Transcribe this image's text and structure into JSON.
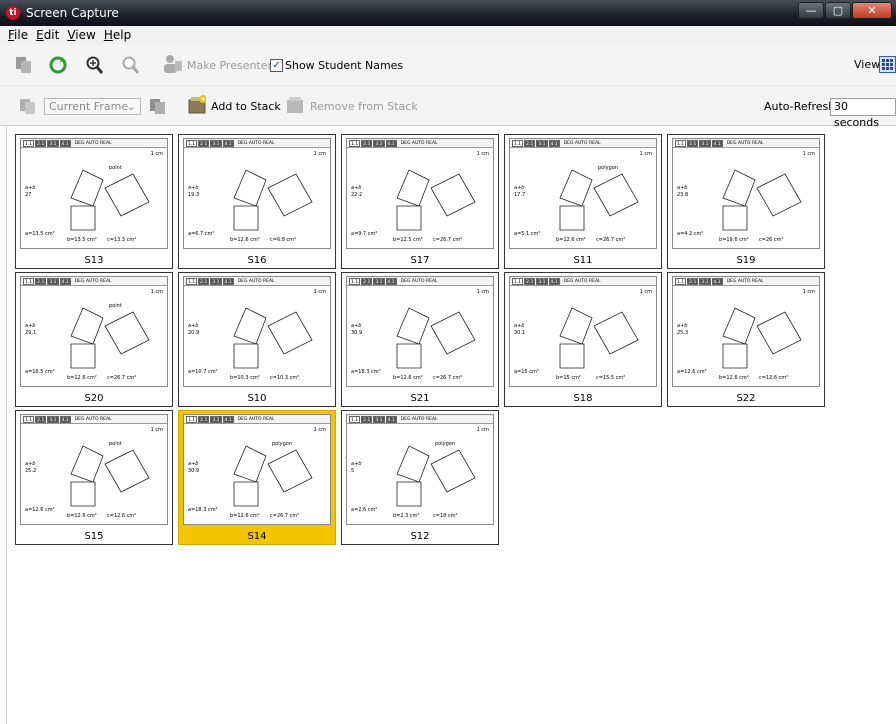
{
  "window": {
    "title": "Screen Capture"
  },
  "menu": [
    {
      "label": "File",
      "key": "F",
      "rest": "ile"
    },
    {
      "label": "Edit",
      "key": "E",
      "rest": "dit"
    },
    {
      "label": "View",
      "key": "V",
      "rest": "iew"
    },
    {
      "label": "Help",
      "key": "H",
      "rest": "elp"
    }
  ],
  "toolbar1": {
    "make_presenter": "Make Presenter",
    "show_student_names": "Show Student Names",
    "show_student_names_checked": true,
    "view_label": "View"
  },
  "toolbar2": {
    "current_frame": "Current Frame",
    "add_to_stack": "Add to Stack",
    "remove_from_stack": "Remove from Stack",
    "auto_refresh_label": "Auto-Refresh:",
    "auto_refresh_value": "30 seconds"
  },
  "page_tabs": [
    "1.1",
    "2.1",
    "3.1",
    "4.1"
  ],
  "page_info": "DEG AUTO REAL",
  "scale_label": "1 cm",
  "selected_student": "S14",
  "students": [
    {
      "name": "S13",
      "ab_label": "a+b",
      "ab_value": "27",
      "a": "a=13.5 cm²",
      "b": "b=13.5 cm²",
      "c": "c=13.3 cm²",
      "tool": "point"
    },
    {
      "name": "S16",
      "ab_label": "a+b",
      "ab_value": "19.3",
      "a": "a=6.7 cm²",
      "b": "b=12.6 cm²",
      "c": "c=6.8 cm²",
      "tool": ""
    },
    {
      "name": "S17",
      "ab_label": "a+b",
      "ab_value": "22.2",
      "a": "a=9.7 cm²",
      "b": "b=12.5 cm²",
      "c": "c=26.7 cm²",
      "tool": ""
    },
    {
      "name": "S11",
      "ab_label": "a+b",
      "ab_value": "17.7",
      "a": "a=5.1 cm²",
      "b": "b=12.6 cm²",
      "c": "c=26.7 cm²",
      "tool": "polygon"
    },
    {
      "name": "S19",
      "ab_label": "a+b",
      "ab_value": "23.8",
      "a": "a=4.2 cm²",
      "b": "b=19.6 cm²",
      "c": "c=26 cm²",
      "tool": ""
    },
    {
      "name": "S20",
      "ab_label": "a+b",
      "ab_value": "29.1",
      "a": "a=16.5 cm²",
      "b": "b=12.6 cm²",
      "c": "c=26.7 cm²",
      "tool": "point"
    },
    {
      "name": "S10",
      "ab_label": "a+b",
      "ab_value": "20.9",
      "a": "a=10.7 cm²",
      "b": "b=10.3 cm²",
      "c": "c=10.3 cm²",
      "tool": ""
    },
    {
      "name": "S21",
      "ab_label": "a+b",
      "ab_value": "30.9",
      "a": "a=18.3 cm²",
      "b": "b=12.6 cm²",
      "c": "c=26.7 cm²",
      "tool": ""
    },
    {
      "name": "S18",
      "ab_label": "a+b",
      "ab_value": "30.1",
      "a": "a=15 cm²",
      "b": "b=15 cm²",
      "c": "c=15.5 cm²",
      "tool": ""
    },
    {
      "name": "S22",
      "ab_label": "a+b",
      "ab_value": "25.3",
      "a": "a=12.6 cm²",
      "b": "b=12.6 cm²",
      "c": "c=12.6 cm²",
      "tool": ""
    },
    {
      "name": "S15",
      "ab_label": "a+b",
      "ab_value": "25.2",
      "a": "a=12.6 cm²",
      "b": "b=12.6 cm²",
      "c": "c=12.6 cm²",
      "tool": "point"
    },
    {
      "name": "S14",
      "ab_label": "a+b",
      "ab_value": "30.9",
      "a": "a=18.3 cm²",
      "b": "b=12.6 cm²",
      "c": "c=26.7 cm²",
      "tool": "polygon"
    },
    {
      "name": "S12",
      "ab_label": "a+b",
      "ab_value": "5",
      "a": "a=2.6 cm²",
      "b": "b=2.3 cm²",
      "c": "c=18 cm²",
      "tool": "polygon"
    }
  ]
}
